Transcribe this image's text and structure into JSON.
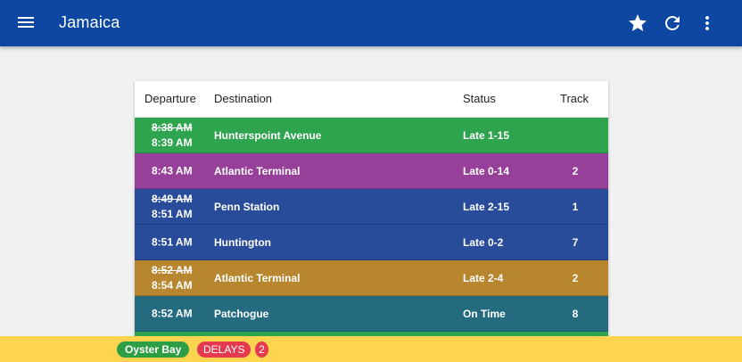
{
  "app": {
    "title": "Jamaica"
  },
  "icons": {
    "menu": "menu-icon",
    "favorite": "star-icon",
    "refresh": "refresh-icon",
    "more": "more-vert-icon"
  },
  "table": {
    "headers": {
      "departure": "Departure",
      "destination": "Destination",
      "status": "Status",
      "track": "Track"
    },
    "rows": [
      {
        "scheduled": "8:38 AM",
        "departure": "8:39 AM",
        "destination": "Hunterspoint Avenue",
        "status": "Late 1-15",
        "track": "",
        "color": "#2ea44f"
      },
      {
        "scheduled": "",
        "departure": "8:43 AM",
        "destination": "Atlantic Terminal",
        "status": "Late 0-14",
        "track": "2",
        "color": "#97409a"
      },
      {
        "scheduled": "8:49 AM",
        "departure": "8:51 AM",
        "destination": "Penn Station",
        "status": "Late 2-15",
        "track": "1",
        "color": "#284b9a"
      },
      {
        "scheduled": "",
        "departure": "8:51 AM",
        "destination": "Huntington",
        "status": "Late 0-2",
        "track": "7",
        "color": "#284b9a"
      },
      {
        "scheduled": "8:52 AM",
        "departure": "8:54 AM",
        "destination": "Atlantic Terminal",
        "status": "Late 2-4",
        "track": "2",
        "color": "#b8862f"
      },
      {
        "scheduled": "",
        "departure": "8:52 AM",
        "destination": "Patchogue",
        "status": "On Time",
        "track": "8",
        "color": "#256b80"
      },
      {
        "scheduled": "",
        "departure": "",
        "destination": "",
        "status": "",
        "track": "",
        "color": "#2ea44f"
      }
    ]
  },
  "footer": {
    "branch": "Oyster Bay",
    "alert": "DELAYS",
    "alert_count": "2"
  },
  "colors": {
    "appbar": "#0d47a1",
    "footer": "#ffd54f",
    "branch_chip": "#2e9e44",
    "alert_chip": "#e53950"
  }
}
